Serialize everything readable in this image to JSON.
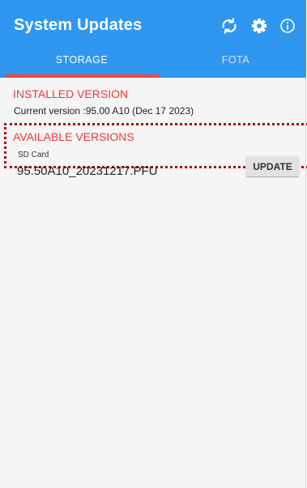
{
  "app_bar": {
    "title": "System Updates",
    "actions": [
      {
        "icon": "refresh-icon"
      },
      {
        "icon": "gear-icon"
      },
      {
        "icon": "info-icon"
      }
    ]
  },
  "tabs": [
    {
      "label": "STORAGE",
      "active": true
    },
    {
      "label": "FOTA",
      "active": false
    }
  ],
  "installed": {
    "header": "INSTALLED VERSION",
    "current_version": "Current version :95.00 A10 (Dec 17 2023)"
  },
  "available": {
    "header": "AVAILABLE VERSIONS",
    "items": [
      {
        "source": "SD Card",
        "file_name": "95.50A10_20231217.PFU",
        "button_label": "UPDATE"
      }
    ]
  },
  "colors": {
    "app_bar": "#2f97f0",
    "section_header": "#ef3838",
    "tab_indicator": "#f7453e",
    "highlight_border": "#a50f13"
  }
}
